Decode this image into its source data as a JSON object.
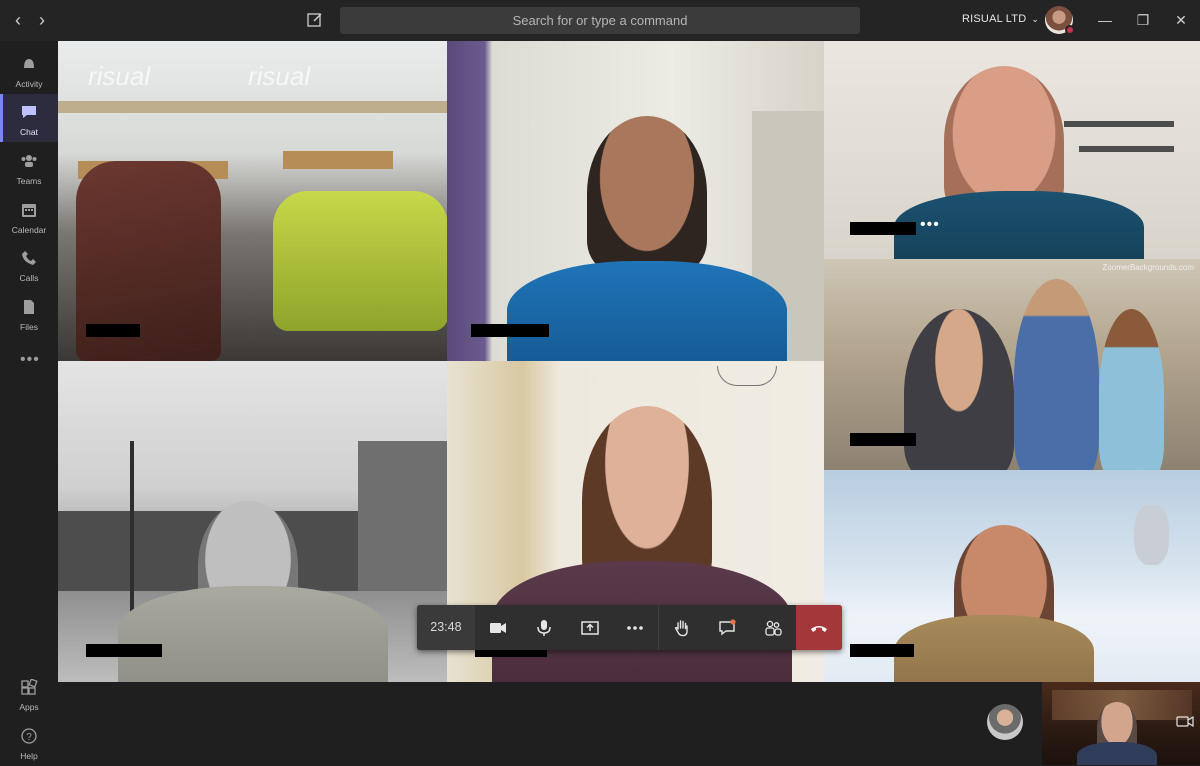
{
  "titlebar": {
    "back_icon": "chevron-left-icon",
    "forward_icon": "chevron-right-icon",
    "compose_icon": "compose-icon",
    "search_placeholder": "Search for or type a command",
    "org_name": "RISUAL LTD",
    "presence_color": "#c4314b"
  },
  "rail": {
    "items": [
      {
        "label": "Activity",
        "icon": "bell-icon"
      },
      {
        "label": "Chat",
        "icon": "chat-icon",
        "active": true
      },
      {
        "label": "Teams",
        "icon": "teams-icon"
      },
      {
        "label": "Calendar",
        "icon": "calendar-icon"
      },
      {
        "label": "Calls",
        "icon": "phone-icon"
      },
      {
        "label": "Files",
        "icon": "file-icon"
      }
    ],
    "bottom": [
      {
        "label": "Apps",
        "icon": "apps-icon"
      },
      {
        "label": "Help",
        "icon": "help-icon"
      }
    ],
    "accent": "#7f85f5"
  },
  "call": {
    "duration": "23:48",
    "controls": [
      "camera-icon",
      "microphone-icon",
      "share-screen-icon",
      "more-icon",
      "raise-hand-icon",
      "chat-icon",
      "participants-icon",
      "hang-up-icon"
    ],
    "hangup_color": "#a4373a",
    "watermark": "risual",
    "background_credit": "ZoomerBackgrounds.com"
  }
}
